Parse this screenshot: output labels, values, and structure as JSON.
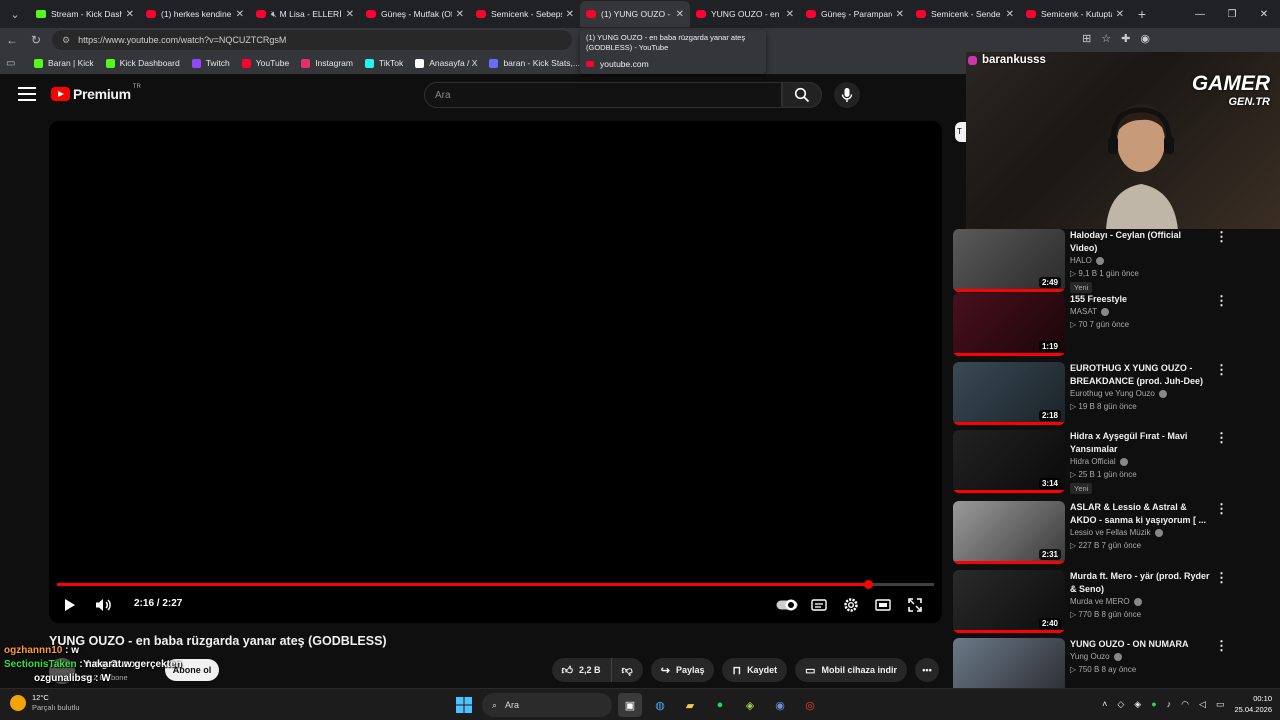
{
  "browser": {
    "tabs": [
      {
        "title": "Stream - Kick Dashbo",
        "favicon": "kick",
        "active": false
      },
      {
        "title": "(1) herkes kendine yaşa",
        "favicon": "yt",
        "active": false
      },
      {
        "title": "M Lisa - ELLERİNE",
        "favicon": "yt",
        "active": false,
        "muted": true
      },
      {
        "title": "Güneş - Mutfak (Offi",
        "favicon": "yt",
        "active": false
      },
      {
        "title": "Semicenk - Sebepsiz",
        "favicon": "yt",
        "active": false
      },
      {
        "title": "(1) YUNG OUZO - en",
        "favicon": "yt",
        "active": true
      },
      {
        "title": "YUNG OUZO - en baba",
        "favicon": "yt",
        "active": false
      },
      {
        "title": "Güneş - Paramparça",
        "favicon": "yt",
        "active": false
      },
      {
        "title": "Semicenk - Sende Ka",
        "favicon": "yt",
        "active": false
      },
      {
        "title": "Semicenk - Kutupta",
        "favicon": "yt",
        "active": false
      }
    ],
    "url": "https://www.youtube.com/watch?v=NQCUZTCRgsM",
    "tooltip": {
      "line1": "(1) YUNG OUZO - en baba rüzgarda yanar ateş",
      "line2": "(GODBLESS) - YouTube",
      "domain": "youtube.com"
    },
    "bookmarks": [
      {
        "label": "Baran | Kick",
        "color": "#53fc18"
      },
      {
        "label": "Kick Dashboard",
        "color": "#53fc18"
      },
      {
        "label": "Twitch",
        "color": "#9146ff"
      },
      {
        "label": "YouTube",
        "color": "#ff0033"
      },
      {
        "label": "Instagram",
        "color": "#e1306c"
      },
      {
        "label": "TikTok",
        "color": "#25f4ee"
      },
      {
        "label": "Anasayfa / X",
        "color": "#ffffff"
      },
      {
        "label": "baran - Kick Stats,...",
        "color": "#6a6aff"
      }
    ]
  },
  "youtube": {
    "logo_text": "Premium",
    "region": "TR",
    "search_placeholder": "Ara",
    "player": {
      "timecode": "2:16 / 2:27",
      "progress_fraction": 0.925
    },
    "video_title": "YUNG OUZO - en baba rüzgarda yanar ateş (GODBLESS)",
    "channel": {
      "name": "Yung Ouzo",
      "subs": "24,2 B abone",
      "subscribe": "Abone ol"
    },
    "actions": {
      "likes": "2,2 B",
      "share": "Paylaş",
      "save": "Kaydet",
      "download": "Mobil cihaza indir"
    },
    "chip_stub": "T",
    "recommendations": [
      {
        "title": "Halodayı - Ceylan (Official Video)",
        "channel": "HALO",
        "meta": "9,1 B  1 gün önce",
        "duration": "2:49",
        "new": "Yeni",
        "colors": [
          "#5a5a5a",
          "#2a2a2a"
        ]
      },
      {
        "title": "155 Freestyle",
        "channel": "MASAT",
        "meta": "70  7 gün önce",
        "duration": "1:19",
        "new": "",
        "colors": [
          "#4a1020",
          "#1a0508"
        ]
      },
      {
        "title": "EUROTHUG X YUNG OUZO - BREAKDANCE (prod. Juh-Dee)",
        "channel": "Eurothug ve Yung Ouzo",
        "meta": "19 B  8 gün önce",
        "duration": "2:18",
        "new": "",
        "colors": [
          "#3a4a55",
          "#1a2228"
        ]
      },
      {
        "title": "Hidra x Ayşegül Fırat - Mavi Yansımalar",
        "channel": "Hidra Official",
        "meta": "25 B  1 gün önce",
        "duration": "3:14",
        "new": "Yeni",
        "colors": [
          "#222222",
          "#0a0a0a"
        ]
      },
      {
        "title": "ASLAR & Lessio & Astral & AKDO - sanma ki yaşıyorum [ ...",
        "channel": "Lessio ve Fellas Müzik",
        "meta": "227 B  7 gün önce",
        "duration": "2:31",
        "new": "",
        "colors": [
          "#9a9a9a",
          "#3a3a3a"
        ]
      },
      {
        "title": "Murda ft. Mero - yär (prod. Ryder & Seno)",
        "channel": "Murda ve MERO",
        "meta": "770 B  8 gün önce",
        "duration": "2:40",
        "new": "",
        "colors": [
          "#2a2a2a",
          "#0c0c0c"
        ]
      },
      {
        "title": "YUNG OUZO - ON NUMARA",
        "channel": "Yung Ouzo",
        "meta": "750 B  8 ay önce",
        "duration": "",
        "new": "",
        "colors": [
          "#6a7a88",
          "#2a2a30"
        ]
      }
    ]
  },
  "overlay": {
    "streamer": "barankusss",
    "watermark_a": "GAMER",
    "watermark_b": "GEN.TR",
    "chat": [
      {
        "user": "ogzhannn10",
        "msg": "w"
      },
      {
        "user": "SectionisTaken",
        "msg": "nakarat w gerçekten"
      },
      {
        "user": "ozgunalibsg",
        "msg": "W"
      }
    ]
  },
  "taskbar": {
    "temp": "12°C",
    "weather": "Parçalı bulutlu",
    "search": "Ara",
    "time": "00:10",
    "date": "25.04.2026"
  }
}
